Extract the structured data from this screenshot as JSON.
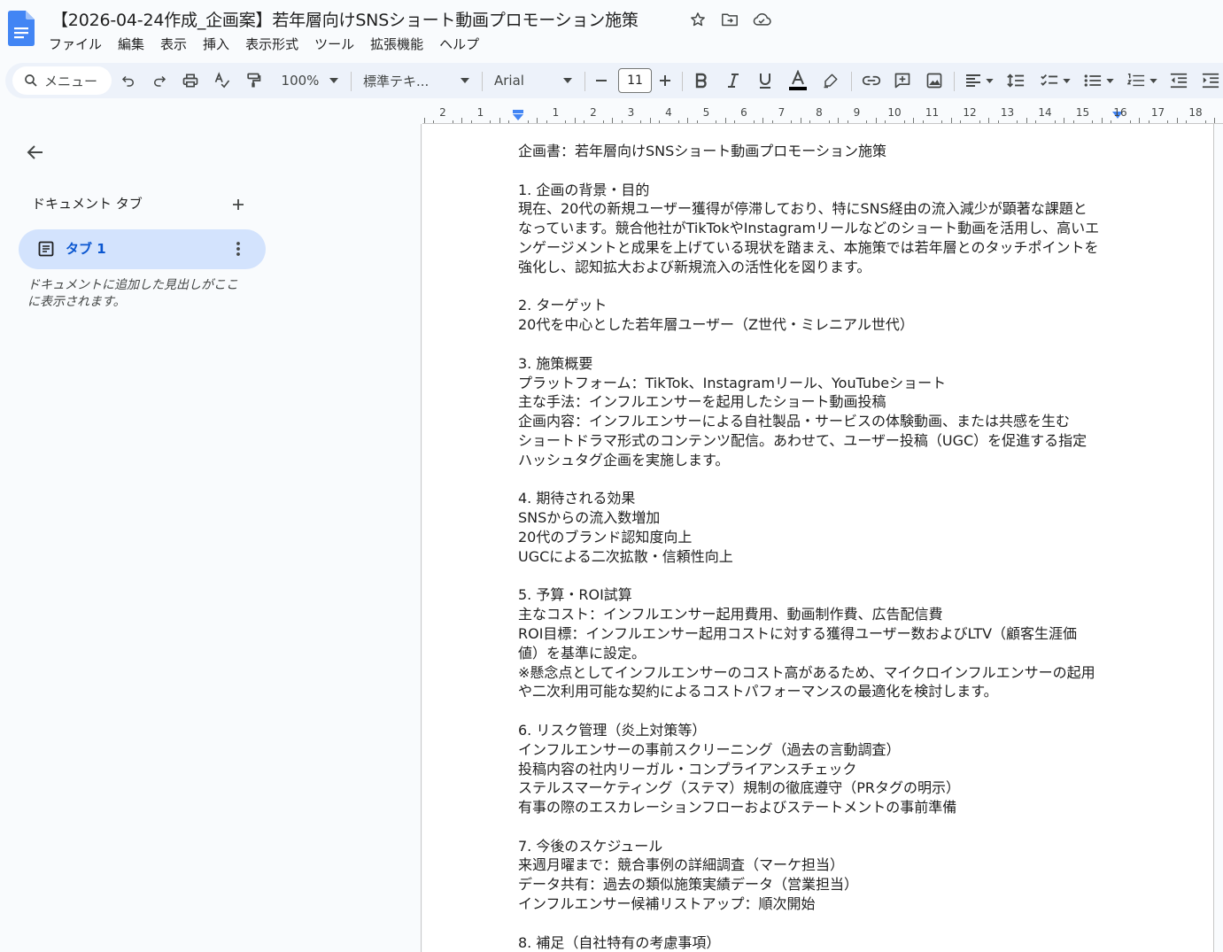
{
  "doc": {
    "title": "【2026-04-24作成_企画案】若年層向けSNSショート動画プロモーション施策"
  },
  "menubar": [
    "ファイル",
    "編集",
    "表示",
    "挿入",
    "表示形式",
    "ツール",
    "拡張機能",
    "ヘルプ"
  ],
  "toolbar": {
    "menu_search": "メニュー",
    "zoom": "100%",
    "style": "標準テキ...",
    "font": "Arial",
    "font_size": "11"
  },
  "ruler": {
    "labels": [
      "2",
      "1",
      "1",
      "2",
      "3",
      "4",
      "5",
      "6",
      "7",
      "8",
      "9",
      "10",
      "11",
      "12",
      "13",
      "14",
      "15",
      "16",
      "17",
      "18"
    ]
  },
  "sidebar": {
    "heading": "ドキュメント タブ",
    "tab_label": "タブ 1",
    "hint": "ドキュメントに追加した見出しがここに表示されます。"
  },
  "body": {
    "lines": [
      "企画書：若年層向けSNSショート動画プロモーション施策",
      "",
      "1. 企画の背景・目的",
      "現在、20代の新規ユーザー獲得が停滞しており、特にSNS経由の流入減少が顕著な課題と",
      "なっています。競合他社がTikTokやInstagramリールなどのショート動画を活用し、高いエ",
      "ンゲージメントと成果を上げている現状を踏まえ、本施策では若年層とのタッチポイントを",
      "強化し、認知拡大および新規流入の活性化を図ります。",
      "",
      "2. ターゲット",
      "20代を中心とした若年層ユーザー（Z世代・ミレニアル世代）",
      "",
      "3. 施策概要",
      "プラットフォーム：TikTok、Instagramリール、YouTubeショート",
      "主な手法：インフルエンサーを起用したショート動画投稿",
      "企画内容：インフルエンサーによる自社製品・サービスの体験動画、または共感を生む",
      "ショートドラマ形式のコンテンツ配信。あわせて、ユーザー投稿（UGC）を促進する指定",
      "ハッシュタグ企画を実施します。",
      "",
      "4. 期待される効果",
      "SNSからの流入数増加",
      "20代のブランド認知度向上",
      "UGCによる二次拡散・信頼性向上",
      "",
      "5. 予算・ROI試算",
      "主なコスト：インフルエンサー起用費用、動画制作費、広告配信費",
      "ROI目標：インフルエンサー起用コストに対する獲得ユーザー数およびLTV（顧客生涯価",
      "値）を基準に設定。",
      "※懸念点としてインフルエンサーのコスト高があるため、マイクロインフルエンサーの起用",
      "や二次利用可能な契約によるコストパフォーマンスの最適化を検討します。",
      "",
      "6. リスク管理（炎上対策等）",
      "インフルエンサーの事前スクリーニング（過去の言動調査）",
      "投稿内容の社内リーガル・コンプライアンスチェック",
      "ステルスマーケティング（ステマ）規制の徹底遵守（PRタグの明示）",
      "有事の際のエスカレーションフローおよびステートメントの事前準備",
      "",
      "7. 今後のスケジュール",
      "来週月曜まで：競合事例の詳細調査（マーケ担当）",
      "データ共有：過去の類似施策実績データ（営業担当）",
      "インフルエンサー候補リストアップ：順次開始",
      "",
      "8. 補足（自社特有の考慮事項）"
    ]
  },
  "colors": {
    "accent_blue": "#0b57d0",
    "toolbar_bg": "#edf2fa",
    "tab_chip_bg": "#d3e3fd",
    "doc_icon_blue": "#4285f4"
  }
}
